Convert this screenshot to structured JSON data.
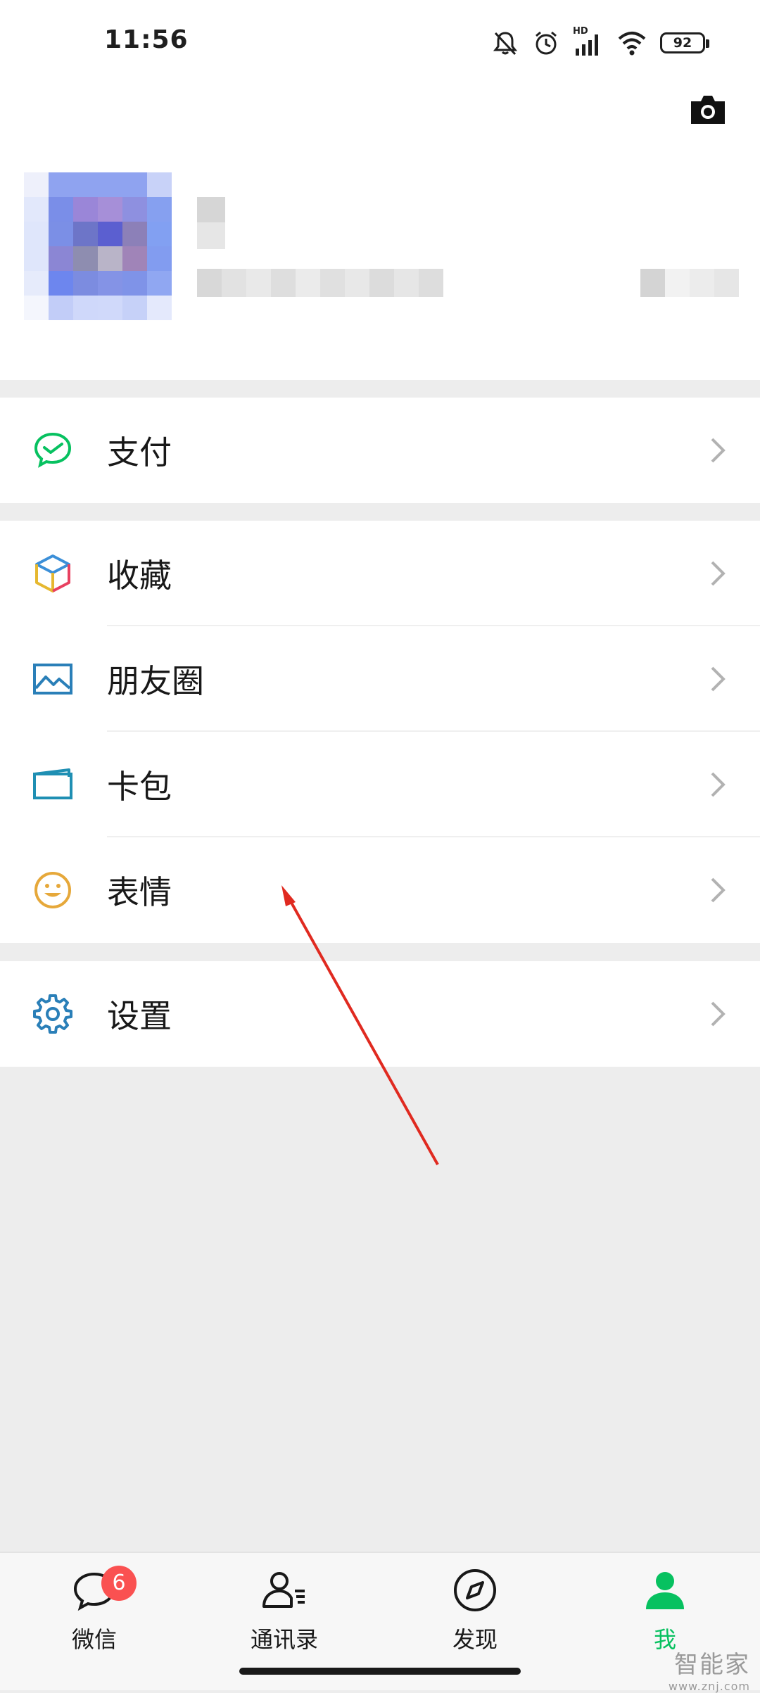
{
  "status_bar": {
    "time": "11:56",
    "network_label": "HD",
    "battery_level": "92",
    "icons": [
      "mute-bell-icon",
      "alarm-icon",
      "signal-icon",
      "wifi-icon",
      "battery-icon"
    ]
  },
  "profile": {
    "camera_icon": "camera-icon"
  },
  "menu": {
    "pay": {
      "label": "支付",
      "icon": "wechat-pay-icon",
      "color": "#07c160"
    },
    "favorites": {
      "label": "收藏",
      "icon": "favorites-cube-icon"
    },
    "moments": {
      "label": "朋友圈",
      "icon": "moments-photo-icon",
      "color": "#2a7fb8"
    },
    "cards": {
      "label": "卡包",
      "icon": "card-wallet-icon",
      "color": "#1f8fb3"
    },
    "stickers": {
      "label": "表情",
      "icon": "smiley-icon",
      "color": "#e6a83a"
    },
    "settings": {
      "label": "设置",
      "icon": "gear-icon",
      "color": "#2a7fb8"
    }
  },
  "tabbar": {
    "tabs": [
      {
        "label": "微信",
        "icon": "chat-bubble-icon",
        "badge": "6"
      },
      {
        "label": "通讯录",
        "icon": "contacts-icon"
      },
      {
        "label": "发现",
        "icon": "compass-icon"
      },
      {
        "label": "我",
        "icon": "person-icon",
        "active": true
      }
    ],
    "active_color": "#07c160"
  },
  "watermark": {
    "main": "智能家",
    "sub": "www.znj.com"
  }
}
